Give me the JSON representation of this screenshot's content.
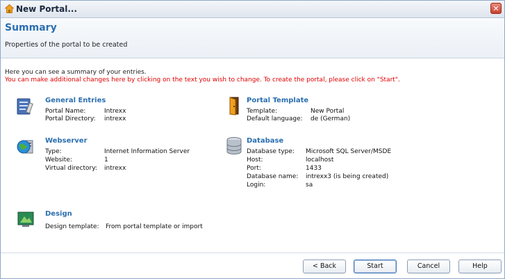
{
  "window": {
    "title": "New Portal...",
    "close_label": "✕"
  },
  "header": {
    "title": "Summary",
    "subtitle": "Properties of the portal to be created"
  },
  "intro": {
    "line1": "Here you can see a summary of your entries.",
    "line2": "You can make additional changes here by clicking on the text you wish to change. To create the portal, please click on \"Start\"."
  },
  "sections": {
    "general": {
      "title": "General Entries",
      "icon": "general-entries-icon",
      "rows": [
        {
          "label": "Portal Name:",
          "value": "Intrexx"
        },
        {
          "label": "Portal Directory:",
          "value": "intrexx"
        }
      ]
    },
    "template": {
      "title": "Portal Template",
      "icon": "door-icon",
      "rows": [
        {
          "label": "Template:",
          "value": "New Portal"
        },
        {
          "label": "Default language:",
          "value": "de (German)"
        }
      ]
    },
    "webserver": {
      "title": "Webserver",
      "icon": "globe-server-icon",
      "rows": [
        {
          "label": "Type:",
          "value": "Internet Information Server"
        },
        {
          "label": "Website:",
          "value": "1"
        },
        {
          "label": "Virtual directory:",
          "value": "intrexx"
        }
      ]
    },
    "database": {
      "title": "Database",
      "icon": "database-icon",
      "rows": [
        {
          "label": "Database type:",
          "value": "Microsoft SQL Server/MSDE"
        },
        {
          "label": "Host:",
          "value": "localhost"
        },
        {
          "label": "Port:",
          "value": "1433"
        },
        {
          "label": "Database name:",
          "value": "intrexx3 (is being created)"
        },
        {
          "label": "Login:",
          "value": "sa"
        }
      ]
    },
    "design": {
      "title": "Design",
      "icon": "design-icon",
      "rows": [
        {
          "label": "Design template:",
          "value": "From portal template or import"
        }
      ]
    }
  },
  "buttons": {
    "back": "< Back",
    "start": "Start",
    "cancel": "Cancel",
    "help": "Help"
  },
  "colors": {
    "accent": "#2b6fb0",
    "warning": "#e00000"
  }
}
